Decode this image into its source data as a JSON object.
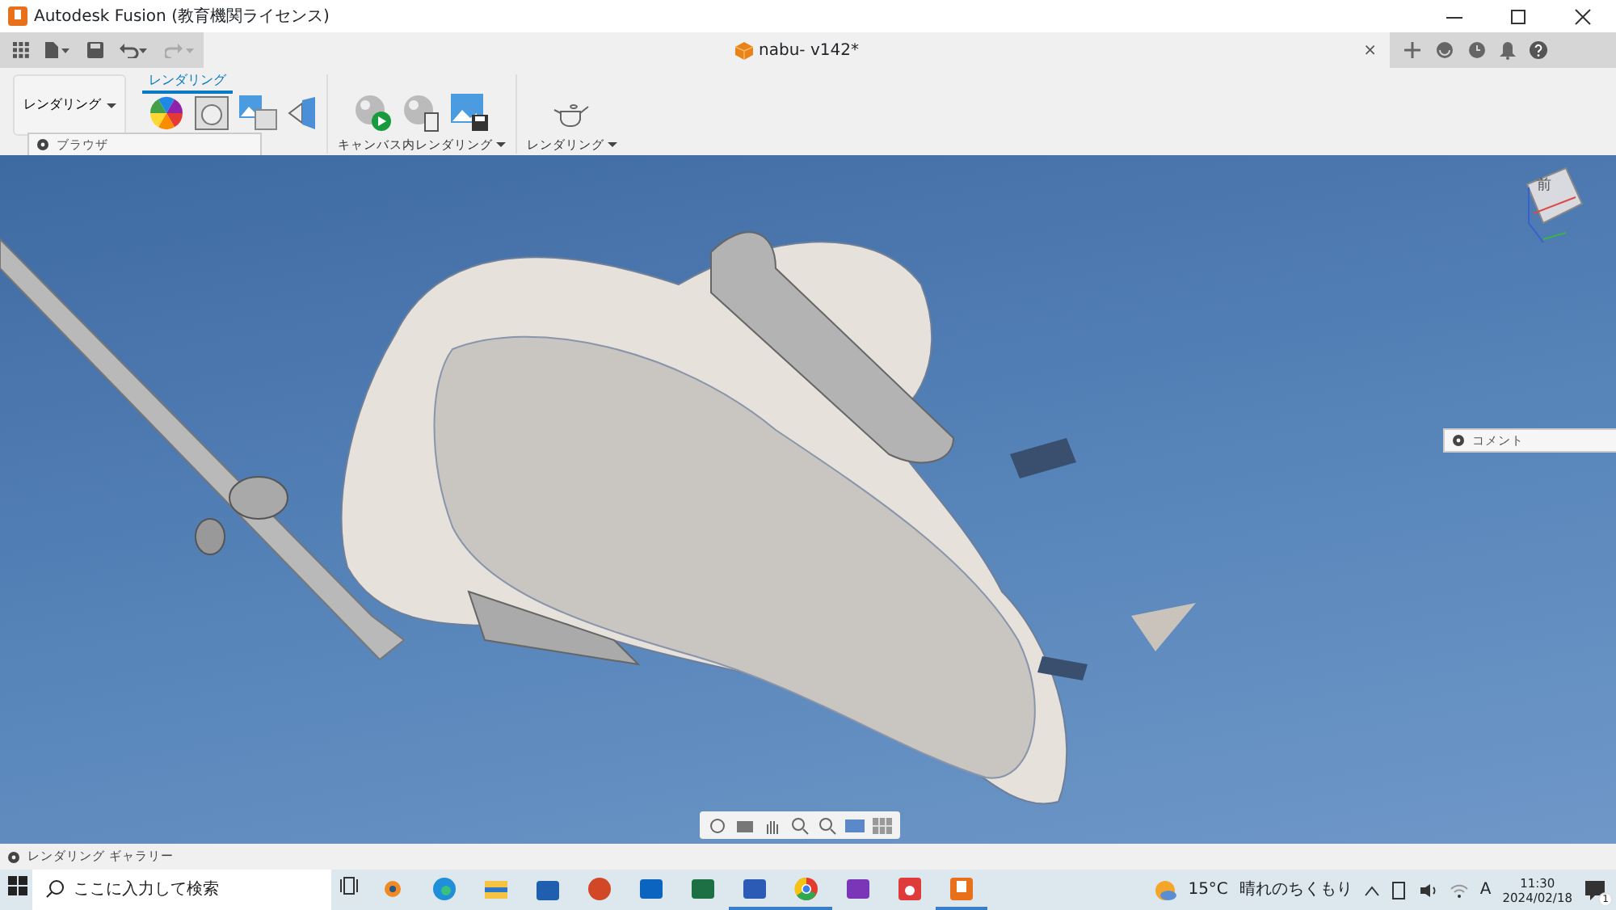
{
  "window": {
    "title": "Autodesk Fusion (教育機関ライセンス)"
  },
  "document_tab": {
    "title": "nabu- v142*",
    "close": "×"
  },
  "ribbon": {
    "workspace": "レンダリング",
    "tabs": [
      {
        "label": "レンダリング",
        "selected": true
      }
    ],
    "groups": [
      {
        "label": "キャンバス内レンダリング"
      },
      {
        "label": "レンダリング"
      }
    ]
  },
  "browser_panel": {
    "label": "ブラウザ"
  },
  "view_cube": {
    "label": "前"
  },
  "comments_panel": {
    "label": "コメント"
  },
  "gallery": {
    "label": "レンダリング ギャラリー"
  },
  "taskbar": {
    "search": {
      "placeholder": "ここに入力して検索"
    },
    "apps": [
      {
        "kind": "blender",
        "running": false
      },
      {
        "kind": "edge",
        "running": false
      },
      {
        "kind": "explorer",
        "running": false
      },
      {
        "kind": "store",
        "running": false
      },
      {
        "kind": "powerpoint",
        "running": false
      },
      {
        "kind": "outlook",
        "running": false
      },
      {
        "kind": "excel",
        "running": false
      },
      {
        "kind": "word",
        "running": true
      },
      {
        "kind": "chrome",
        "running": true
      },
      {
        "kind": "onenote",
        "running": false
      },
      {
        "kind": "tool",
        "running": false
      },
      {
        "kind": "fusion",
        "running": true
      }
    ],
    "weather": {
      "temperature": "15°C",
      "condition": "晴れのちくもり"
    },
    "ime": "A",
    "time": "11:30",
    "date": "2024/02/18",
    "notifications": "1"
  }
}
